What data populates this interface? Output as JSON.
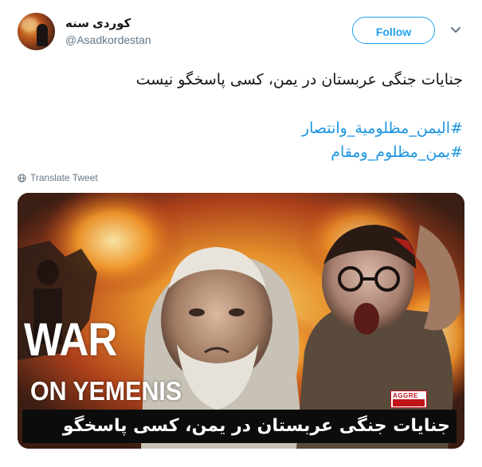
{
  "user": {
    "name": "کوردی سنه",
    "handle": "@Asadkordestan",
    "avatar_icon": "avatar-image"
  },
  "follow_button": {
    "label": "Follow"
  },
  "menu": {
    "icon": "chevron-down-icon"
  },
  "tweet": {
    "text": "جنایات جنگی عربستان در یمن، کسی پاسخگو نیست",
    "hashtags": [
      "#الیمن_مظلومیة_وانتصار",
      "#یمن_مظلوم_ومقام"
    ],
    "translate_label": "Translate Tweet",
    "translate_icon": "globe-icon"
  },
  "media": {
    "headline": "WAR",
    "subheadline": "ON YEMENIS",
    "caption": "جنایات جنگی عربستان در یمن، کسی پاسخگو نیست",
    "logo_text": "AGGRE"
  },
  "colors": {
    "accent": "#1da1f2",
    "hashtag": "#1b95e0",
    "secondary_text": "#657786",
    "primary_text": "#14171a"
  }
}
